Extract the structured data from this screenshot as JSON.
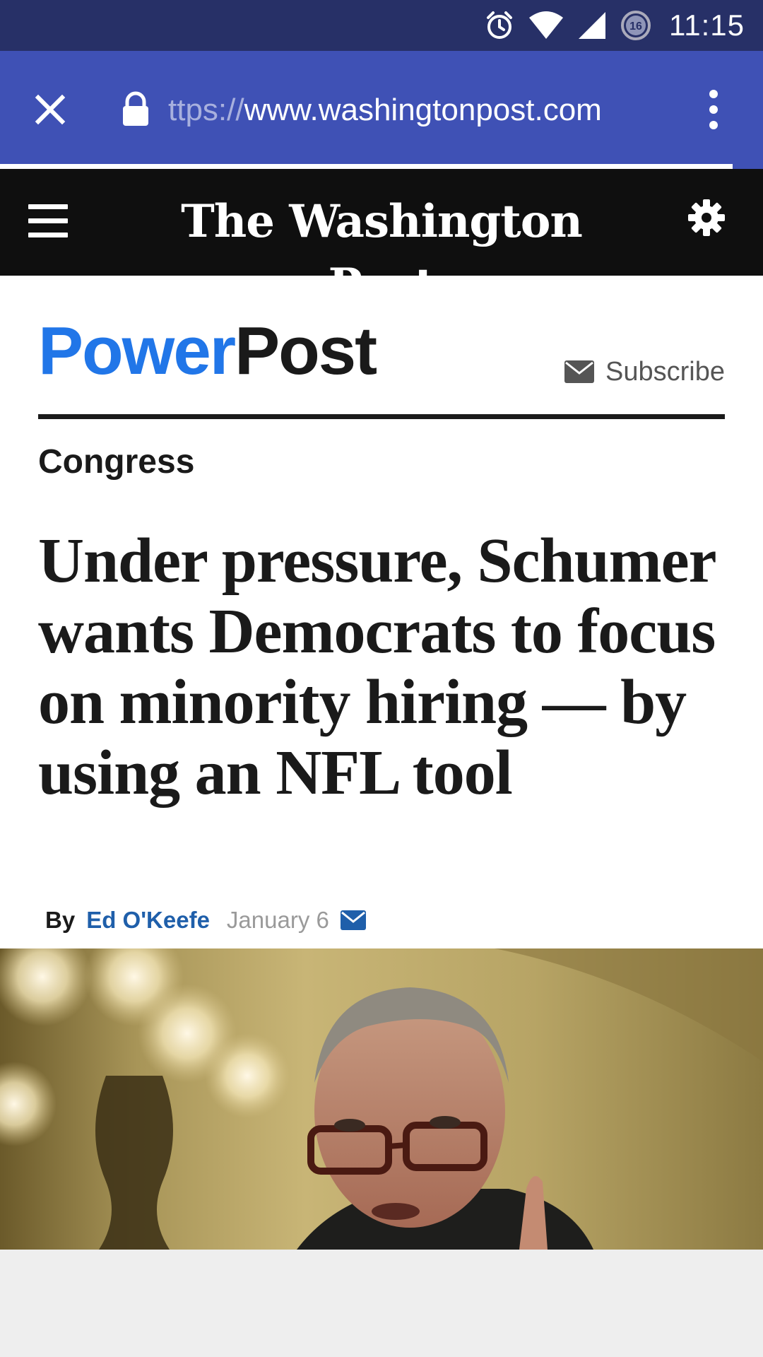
{
  "status_bar": {
    "time": "11:15",
    "icons": [
      "alarm-icon",
      "wifi-icon",
      "cell-signal-icon",
      "data-saver-icon"
    ],
    "badge": "16"
  },
  "browser": {
    "url_scheme": "ttps://",
    "url_host": "www.washingtonpost.com",
    "load_progress": 0.96
  },
  "header": {
    "masthead": "The Washington Post"
  },
  "section": {
    "brand_part1": "Power",
    "brand_part2": "Post",
    "subscribe_label": "Subscribe"
  },
  "article": {
    "kicker": "Congress",
    "headline": "Under pressure, Schumer wants Democrats to focus on minority hiring — by using an NFL tool",
    "by_label": "By",
    "author": "Ed O'Keefe",
    "date": "January 6"
  },
  "colors": {
    "status_bar": "#273067",
    "toolbar": "#3f51b5",
    "header": "#0f0f0f",
    "power_blue": "#2176e8",
    "author_link": "#1f5faa"
  }
}
